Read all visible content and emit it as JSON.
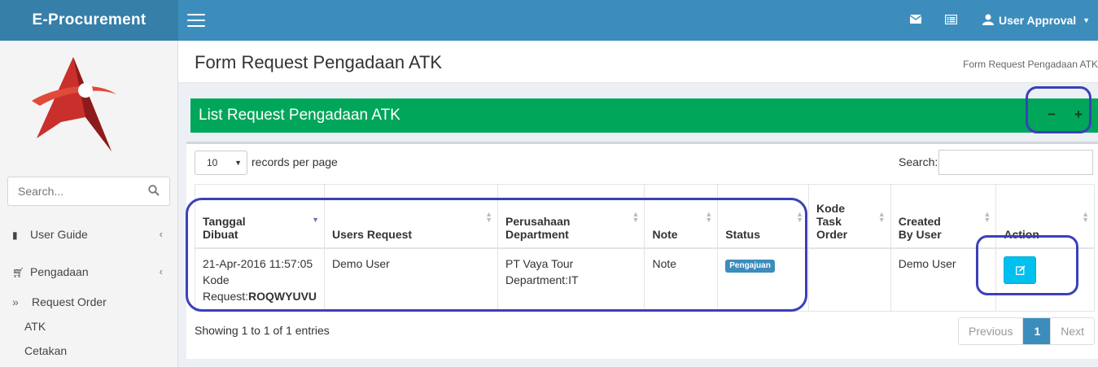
{
  "app": {
    "title": "E-Procurement",
    "user": "User Approval"
  },
  "sidebar": {
    "search_placeholder": "Search...",
    "items": [
      {
        "label": "User Guide"
      },
      {
        "label": "Pengadaan"
      }
    ],
    "sub_items": [
      {
        "label": "Request Order"
      },
      {
        "label": "ATK"
      },
      {
        "label": "Cetakan"
      }
    ]
  },
  "header": {
    "title": "Form Request Pengadaan ATK",
    "breadcrumb": "Form Request Pengadaan ATK"
  },
  "box": {
    "title": "List Request Pengadaan ATK",
    "collapse": "−",
    "expand": "+"
  },
  "table_controls": {
    "length_value": "10",
    "length_text": "records per page",
    "search_label": "Search:"
  },
  "table": {
    "headers": [
      "Tanggal\nDibuat",
      "Users Request",
      "Perusahaan\nDepartment",
      "Note",
      "Status",
      "Kode\nTask\nOrder",
      "Created\nBy User",
      "Action"
    ],
    "rows": [
      {
        "tanggal": "21-Apr-2016 11:57:05",
        "kode_label": "Kode Request:",
        "kode_value": "ROQWYUVU",
        "user": "Demo User",
        "perusahaan": "PT Vaya Tour",
        "department": "Department:IT",
        "note": "Note",
        "status": "Pengajuan",
        "task_order": "",
        "created_by": "Demo User"
      }
    ]
  },
  "footer": {
    "info": "Showing 1 to 1 of 1 entries",
    "prev": "Previous",
    "page": "1",
    "next": "Next"
  },
  "colors": {
    "navbar": "#3c8dbc",
    "logo_bg": "#367fa9",
    "box_header": "#00a65a",
    "badge": "#3c8dbc",
    "edit_button": "#00c0ef",
    "annotation": "#3b40b8"
  }
}
